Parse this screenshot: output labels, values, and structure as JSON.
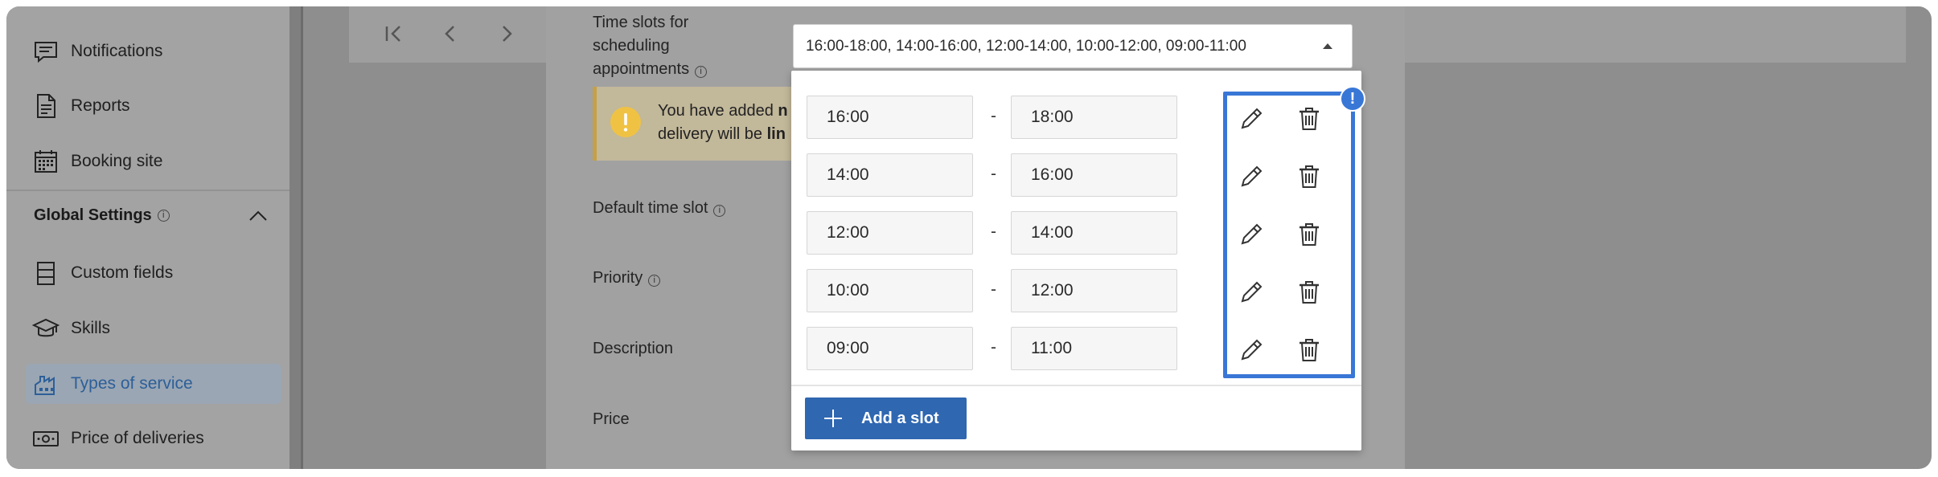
{
  "sidebar": {
    "items_top": [
      {
        "label": "Notifications",
        "icon": "notifications-icon"
      },
      {
        "label": "Reports",
        "icon": "reports-icon"
      },
      {
        "label": "Booking site",
        "icon": "calendar-icon"
      }
    ],
    "section": {
      "label": "Global Settings",
      "info": "i"
    },
    "items_bottom": [
      {
        "label": "Custom fields",
        "icon": "custom-fields-icon"
      },
      {
        "label": "Skills",
        "icon": "skills-icon"
      },
      {
        "label": "Types of service",
        "icon": "types-of-service-icon",
        "active": true
      },
      {
        "label": "Price of deliveries",
        "icon": "price-icon"
      }
    ]
  },
  "pager": {
    "icons": [
      "first-page-icon",
      "previous-page-icon",
      "next-page-icon"
    ]
  },
  "modal": {
    "time_slots_label_lines": [
      "Time slots for",
      "scheduling",
      "appointments"
    ],
    "select_value": "16:00-18:00, 14:00-16:00, 12:00-14:00, 10:00-12:00, 09:00-11:00",
    "warning": {
      "line1_prefix": "You have added ",
      "line1_bold": "n",
      "line2_prefix": "delivery will be ",
      "line2_bold": "lin"
    },
    "labels": {
      "default_time_slot": "Default time slot",
      "priority": "Priority",
      "description": "Description",
      "price": "Price"
    },
    "info": "i"
  },
  "dropdown": {
    "separator": "-",
    "slots": [
      {
        "from": "16:00",
        "to": "18:00"
      },
      {
        "from": "14:00",
        "to": "16:00"
      },
      {
        "from": "12:00",
        "to": "14:00"
      },
      {
        "from": "10:00",
        "to": "12:00"
      },
      {
        "from": "09:00",
        "to": "11:00"
      }
    ],
    "badge": "!",
    "add_label": "Add a slot"
  },
  "colors": {
    "accent": "#3977d6",
    "button": "#2f67b1",
    "warning": "#f0c244",
    "overlay": "#8e8e8e"
  }
}
